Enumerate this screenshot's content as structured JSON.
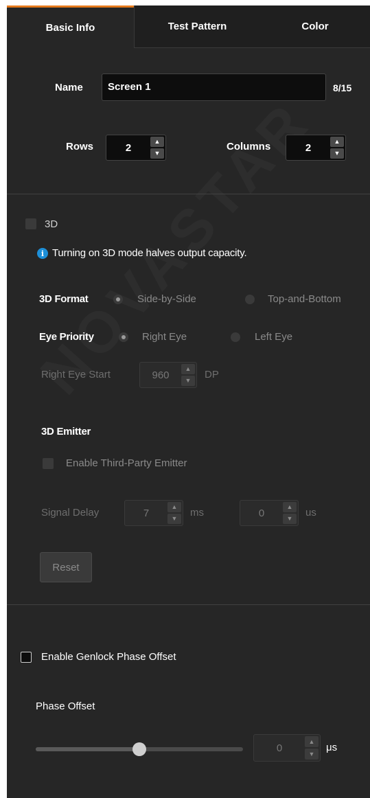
{
  "tabs": [
    {
      "label": "Basic Info",
      "active": true
    },
    {
      "label": "Test Pattern",
      "active": false
    },
    {
      "label": "Color",
      "active": false
    }
  ],
  "basic": {
    "name_label": "Name",
    "name_value": "Screen 1",
    "name_counter": "8/15",
    "rows_label": "Rows",
    "rows_value": "2",
    "columns_label": "Columns",
    "columns_value": "2"
  },
  "three_d": {
    "checkbox_label": "3D",
    "checked": false,
    "info_text": "Turning on 3D mode halves output capacity.",
    "format_label": "3D Format",
    "format_options": [
      "Side-by-Side",
      "Top-and-Bottom"
    ],
    "format_selected": "Side-by-Side",
    "eye_priority_label": "Eye Priority",
    "eye_options": [
      "Right Eye",
      "Left Eye"
    ],
    "eye_selected": "Right Eye",
    "right_eye_start_label": "Right Eye Start",
    "right_eye_start_value": "960",
    "right_eye_start_unit": "DP",
    "emitter_title": "3D Emitter",
    "third_party_label": "Enable Third-Party Emitter",
    "third_party_checked": false,
    "signal_delay_label": "Signal Delay",
    "signal_delay_ms_value": "7",
    "signal_delay_ms_unit": "ms",
    "signal_delay_us_value": "0",
    "signal_delay_us_unit": "us",
    "reset_label": "Reset"
  },
  "genlock": {
    "checkbox_label": "Enable Genlock Phase Offset",
    "checked": false,
    "phase_offset_label": "Phase Offset",
    "phase_offset_value": "0",
    "phase_offset_unit": "μs",
    "slider_level": 0.5
  },
  "watermark_text": "NOVASTAR",
  "colors": {
    "panel_bg": "#262626",
    "accent": "#e57a1d",
    "info_blue": "#1d8fd8"
  },
  "icons": [
    "info-icon",
    "chevron-up-icon",
    "chevron-down-icon"
  ]
}
